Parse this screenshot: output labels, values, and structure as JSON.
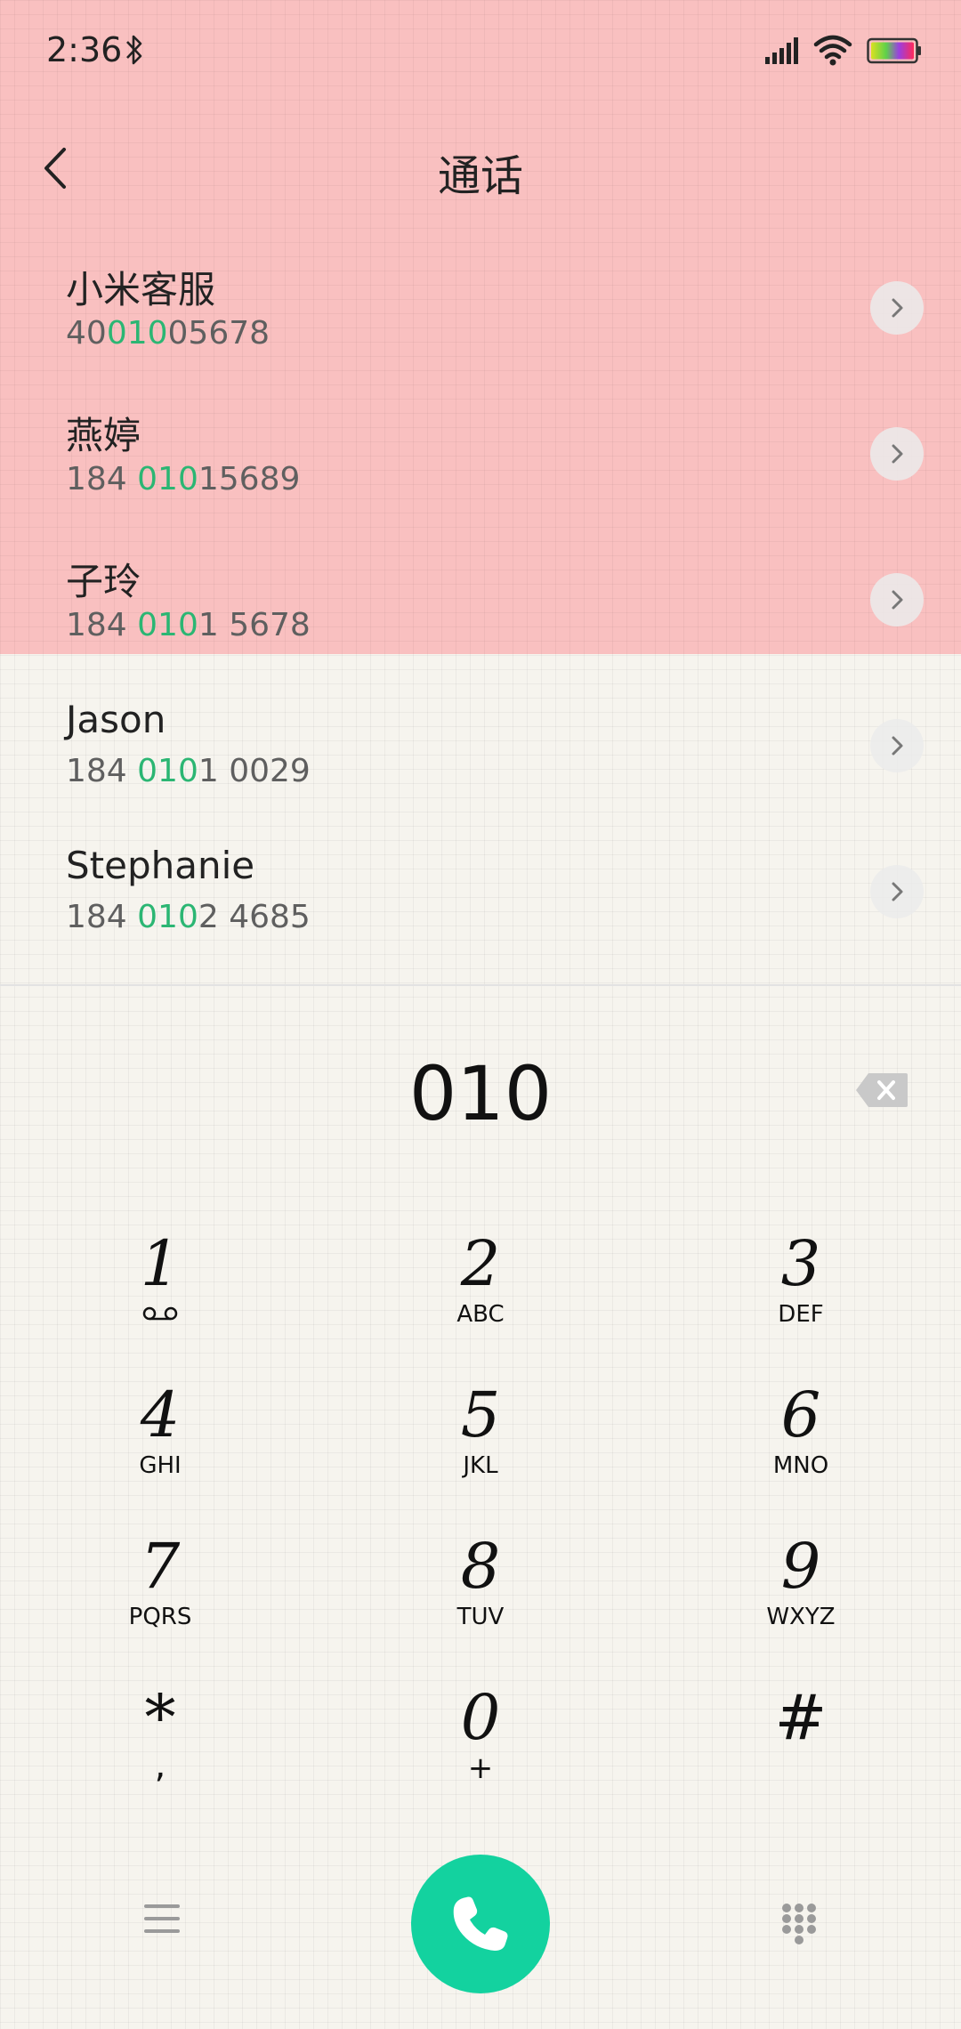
{
  "status": {
    "time": "2:36"
  },
  "header": {
    "title": "通话"
  },
  "contacts": [
    {
      "name": "小米客服",
      "number_pre": "40",
      "number_match": "010",
      "number_post": "05678"
    },
    {
      "name": "燕婷",
      "number_pre": "184 ",
      "number_match": "010",
      "number_post": "15689"
    },
    {
      "name": "子玲",
      "number_pre": "184 ",
      "number_match": "010",
      "number_post": "1 5678"
    },
    {
      "name": "Jason",
      "number_pre": "184 ",
      "number_match": "010",
      "number_post": "1 0029"
    },
    {
      "name": "Stephanie",
      "number_pre": "184 ",
      "number_match": "010",
      "number_post": "2 4685"
    }
  ],
  "dialer": {
    "input": "010"
  },
  "keypad": {
    "keys": [
      {
        "digit": "1",
        "letters": ""
      },
      {
        "digit": "2",
        "letters": "ABC"
      },
      {
        "digit": "3",
        "letters": "DEF"
      },
      {
        "digit": "4",
        "letters": "GHI"
      },
      {
        "digit": "5",
        "letters": "JKL"
      },
      {
        "digit": "6",
        "letters": "MNO"
      },
      {
        "digit": "7",
        "letters": "PQRS"
      },
      {
        "digit": "8",
        "letters": "TUV"
      },
      {
        "digit": "9",
        "letters": "WXYZ"
      },
      {
        "digit": "*",
        "letters": ","
      },
      {
        "digit": "0",
        "letters": "+"
      },
      {
        "digit": "#",
        "letters": ""
      }
    ]
  },
  "colors": {
    "highlight": "#2bb673",
    "call_button": "#13d29f",
    "top_background": "#f9c0c0"
  },
  "icons": {
    "bluetooth": "bluetooth-icon",
    "signal": "signal-icon",
    "wifi": "wifi-icon",
    "battery": "battery-icon",
    "back": "chevron-left-icon",
    "detail": "chevron-right-icon",
    "backspace": "backspace-icon",
    "voicemail": "voicemail-icon",
    "menu": "menu-icon",
    "call": "phone-icon",
    "keypad": "keypad-icon"
  }
}
